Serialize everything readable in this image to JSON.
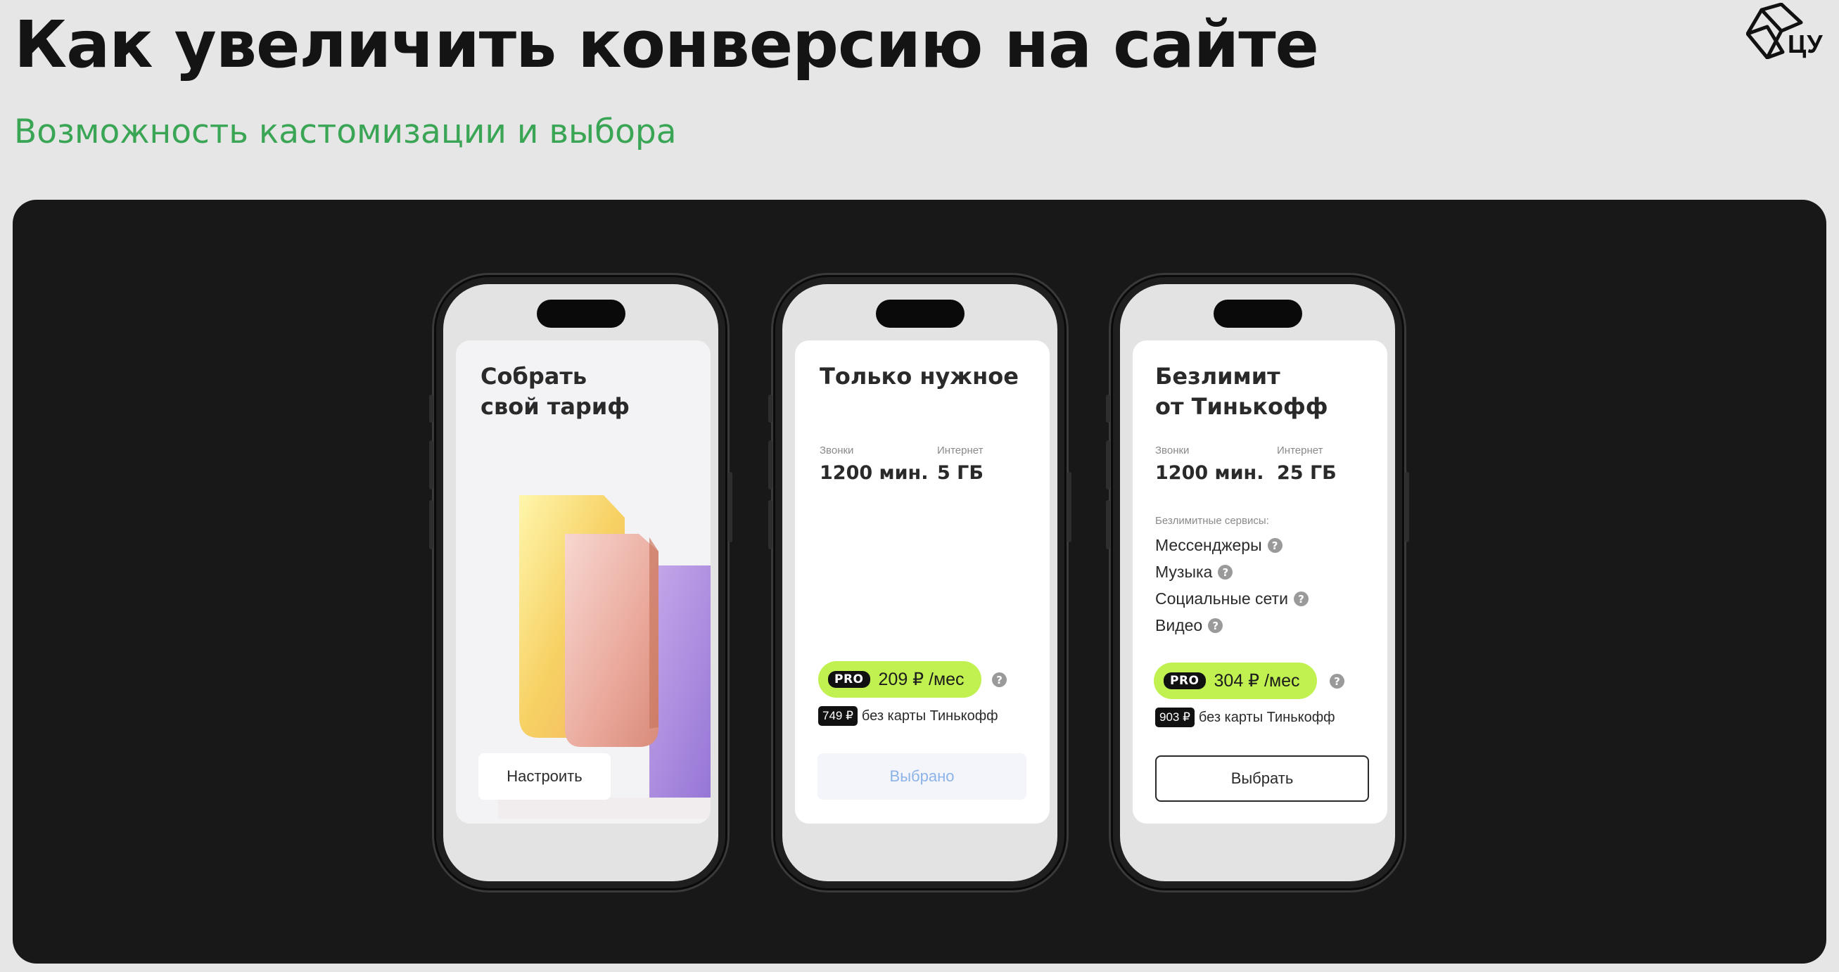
{
  "slide": {
    "title": "Как увеличить конверсию на сайте",
    "subtitle": "Возможность кастомизации и выбора",
    "logo_text": "ЦУ"
  },
  "phones": [
    {
      "card_title": "Собрать\nсвой тариф",
      "button_label": "Настроить"
    },
    {
      "card_title": "Только нужное",
      "calls_label": "Звонки",
      "calls_value": "1200 мин.",
      "internet_label": "Интернет",
      "internet_value": "5 ГБ",
      "pro_badge": "PRO",
      "price": "209 ₽ /мес",
      "promo_price": "749 ₽",
      "promo_text": "без карты Тинькофф",
      "button_label": "Выбрано"
    },
    {
      "card_title": "Безлимит\nот Тинькофф",
      "calls_label": "Звонки",
      "calls_value": "1200 мин.",
      "internet_label": "Интернет",
      "internet_value": "25 ГБ",
      "services_heading": "Безлимитные сервисы:",
      "services": [
        "Мессенджеры",
        "Музыка",
        "Социальные сети",
        "Видео"
      ],
      "pro_badge": "PRO",
      "price": "304 ₽ /мес",
      "promo_price": "903 ₽",
      "promo_text": "без карты Тинькофф",
      "button_label": "Выбрать"
    }
  ],
  "colors": {
    "background": "#e6e6e6",
    "title": "#141414",
    "subtitle": "#3aa655",
    "panel": "#181818",
    "price_pill": "#c1f150",
    "selected_text": "#8bb3e8"
  },
  "icons": {
    "help": "?",
    "logo": "cube-outline-icon"
  }
}
